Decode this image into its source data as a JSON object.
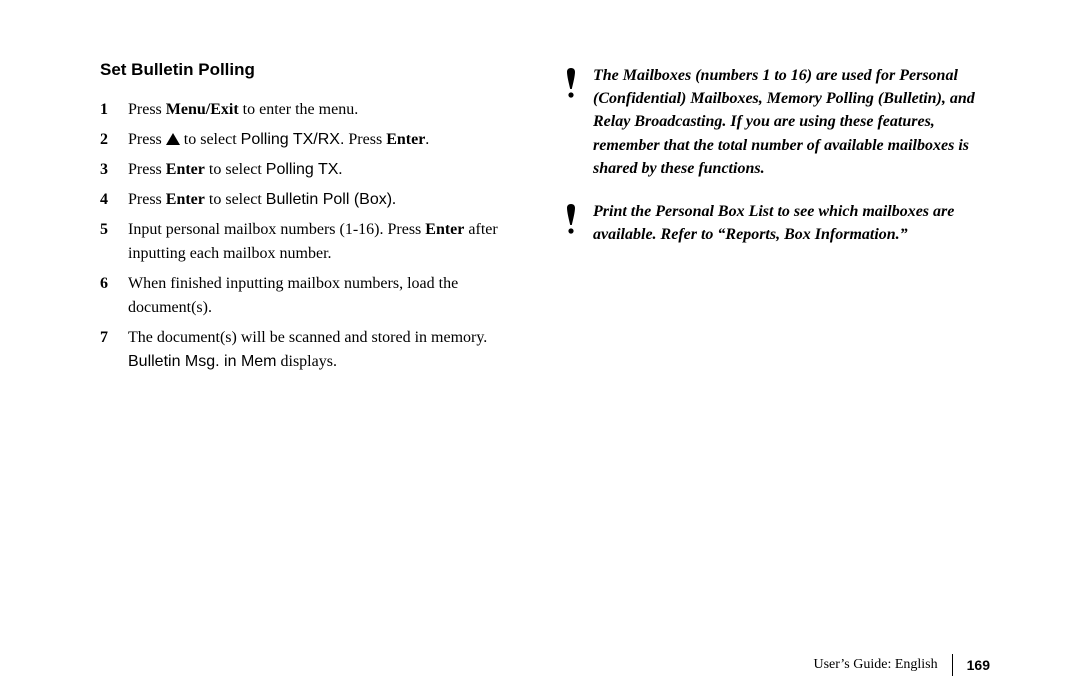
{
  "heading": "Set Bulletin Polling",
  "steps": [
    {
      "num": "1",
      "parts": [
        {
          "t": "Press "
        },
        {
          "t": "Menu/Exit",
          "bold": true
        },
        {
          "t": " to enter the menu."
        }
      ]
    },
    {
      "num": "2",
      "parts": [
        {
          "t": "Press "
        },
        {
          "icon": "up-triangle"
        },
        {
          "t": " to select "
        },
        {
          "t": "Polling TX/RX.",
          "sans": true
        },
        {
          "t": " Press "
        },
        {
          "t": "Enter",
          "bold": true
        },
        {
          "t": "."
        }
      ]
    },
    {
      "num": "3",
      "parts": [
        {
          "t": "Press "
        },
        {
          "t": "Enter",
          "bold": true
        },
        {
          "t": " to select "
        },
        {
          "t": "Polling TX",
          "sans": true
        },
        {
          "t": "."
        }
      ]
    },
    {
      "num": "4",
      "parts": [
        {
          "t": "Press "
        },
        {
          "t": "Enter",
          "bold": true
        },
        {
          "t": " to select "
        },
        {
          "t": "Bulletin Poll (Box)",
          "sans": true
        },
        {
          "t": "."
        }
      ]
    },
    {
      "num": "5",
      "parts": [
        {
          "t": "Input personal mailbox numbers (1-16). Press "
        },
        {
          "t": "Enter",
          "bold": true
        },
        {
          "t": " after inputting each mailbox number."
        }
      ]
    },
    {
      "num": "6",
      "parts": [
        {
          "t": "When finished inputting mailbox numbers, load the document(s)."
        }
      ]
    },
    {
      "num": "7",
      "parts": [
        {
          "t": "The document(s) will be scanned and stored in memory. "
        },
        {
          "t": "Bulletin Msg. in Mem",
          "sans": true
        },
        {
          "t": " displays."
        }
      ]
    }
  ],
  "notes": [
    "The Mailboxes (numbers 1 to 16) are used for Personal (Confidential) Mailboxes, Memory Polling (Bulletin), and Relay Broadcasting.  If you are using these features, remember that the total number of available mailboxes is shared by these functions.",
    "Print the Personal Box List to see which mailboxes are available.  Refer to “Reports, Box Information.”"
  ],
  "footer": {
    "text": "User’s Guide:  English",
    "page": "169"
  }
}
